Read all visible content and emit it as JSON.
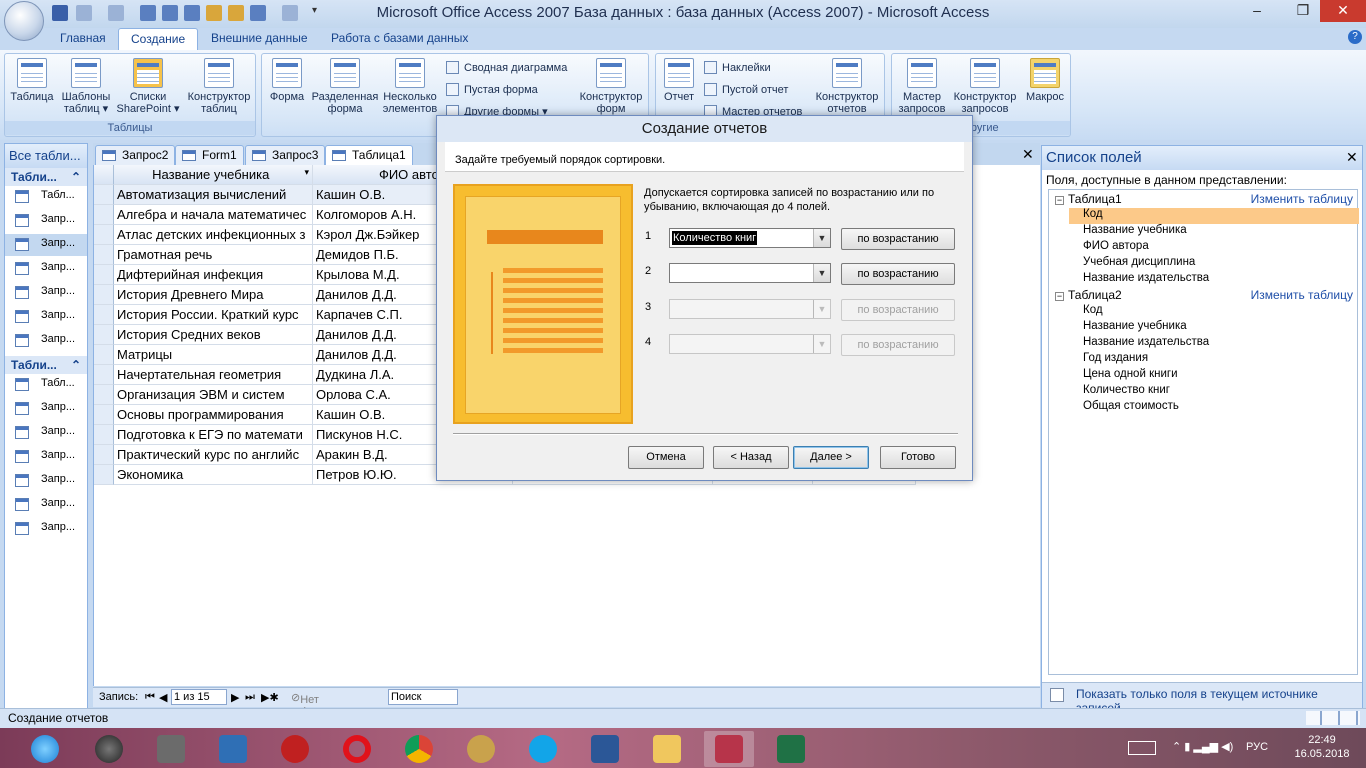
{
  "window": {
    "title": "Microsoft Office Access 2007 База данных : база данных (Access 2007) - Microsoft Access"
  },
  "ribbon_tabs": [
    "Главная",
    "Создание",
    "Внешние данные",
    "Работа с базами данных"
  ],
  "ribbon": {
    "tables_group": {
      "label": "Таблицы",
      "buttons": [
        "Таблица",
        "Шаблоны таблиц ▾",
        "Списки SharePoint ▾",
        "Конструктор таблиц"
      ]
    },
    "forms_group": {
      "buttons": [
        "Форма",
        "Разделенная форма",
        "Несколько элементов"
      ],
      "small": [
        "Сводная диаграмма",
        "Пустая форма",
        "Другие формы ▾"
      ],
      "designer": "Конструктор форм"
    },
    "reports_group": {
      "buttons": [
        "Отчет"
      ],
      "small": [
        "Наклейки",
        "Пустой отчет",
        "Мастер отчетов"
      ],
      "designer": "Конструктор отчетов"
    },
    "other_group": {
      "label": "Другие",
      "buttons": [
        "Мастер запросов",
        "Конструктор запросов",
        "Макрос"
      ]
    }
  },
  "nav": {
    "header": "Все табли...",
    "groups": [
      {
        "label": "Табли...",
        "items": [
          "Табл...",
          "Запр...",
          "Запр...",
          "Запр...",
          "Запр...",
          "Запр...",
          "Запр..."
        ]
      },
      {
        "label": "Табли...",
        "items": [
          "Табл...",
          "Запр...",
          "Запр...",
          "Запр...",
          "Запр...",
          "Запр...",
          "Запр..."
        ]
      }
    ]
  },
  "doc_tabs": [
    "Запрос2",
    "Form1",
    "Запрос3",
    "Таблица1"
  ],
  "datasheet": {
    "columns": [
      "Название учебника",
      "ФИО автор"
    ],
    "rows": [
      [
        "Автоматизация вычислений",
        "Кашин О.В."
      ],
      [
        "Алгебра и начала математичес",
        "Колгоморов А.Н."
      ],
      [
        "Атлас детских инфекционных з",
        "Кэрол Дж.Бэйкер"
      ],
      [
        "Грамотная речь",
        "Демидов П.Б."
      ],
      [
        "Дифтерийная инфекция",
        "Крылова М.Д."
      ],
      [
        "История Древнего Мира",
        "Данилов Д.Д."
      ],
      [
        "История России. Краткий курс",
        "Карпачев С.П."
      ],
      [
        "История Средних веков",
        "Данилов Д.Д."
      ],
      [
        "Матрицы",
        "Данилов Д.Д."
      ],
      [
        "Начертательная геометрия",
        "Дудкина Л.А."
      ],
      [
        "Организация ЭВМ и систем",
        "Орлова С.А."
      ],
      [
        "Основы программирования",
        "Кашин О.В."
      ],
      [
        "Подготовка к ЕГЭ по математи",
        "Пискунов Н.С."
      ],
      [
        "Практический курс по английс",
        "Аракин В.Д."
      ],
      [
        "Экономика",
        "Петров Ю.Ю."
      ]
    ]
  },
  "record_nav": {
    "label": "Запись:",
    "count": "1 из 15",
    "filter": "Нет фильтра",
    "search": "Поиск"
  },
  "field_list": {
    "title": "Список полей",
    "subtitle": "Поля, доступные в данном представлении:",
    "edit_link": "Изменить таблицу",
    "tables": [
      {
        "name": "Таблица1",
        "fields": [
          "Код",
          "Название учебника",
          "ФИО автора",
          "Учебная дисциплина",
          "Название издательства"
        ]
      },
      {
        "name": "Таблица2",
        "fields": [
          "Код",
          "Название учебника",
          "Название издательства",
          "Год издания",
          "Цена одной книги",
          "Количество книг",
          "Общая стоимость"
        ]
      }
    ],
    "footer": "Показать только поля в текущем источнике записей"
  },
  "dialog": {
    "title": "Создание отчетов",
    "header": "Задайте требуемый порядок сортировки.",
    "description": "Допускается сортировка записей по возрастанию или по убыванию, включающая до 4 полей.",
    "sorts": [
      {
        "num": "1",
        "field": "Количество книг",
        "order": "по возрастанию"
      },
      {
        "num": "2",
        "field": "",
        "order": "по возрастанию"
      },
      {
        "num": "3",
        "field": "",
        "order": "по возрастанию"
      },
      {
        "num": "4",
        "field": "",
        "order": "по возрастанию"
      }
    ],
    "buttons": {
      "cancel": "Отмена",
      "back": "< Назад",
      "next": "Далее >",
      "finish": "Готово"
    }
  },
  "status": "Создание отчетов",
  "tray": {
    "lang": "РУС",
    "time": "22:49",
    "date": "16.05.2018"
  }
}
